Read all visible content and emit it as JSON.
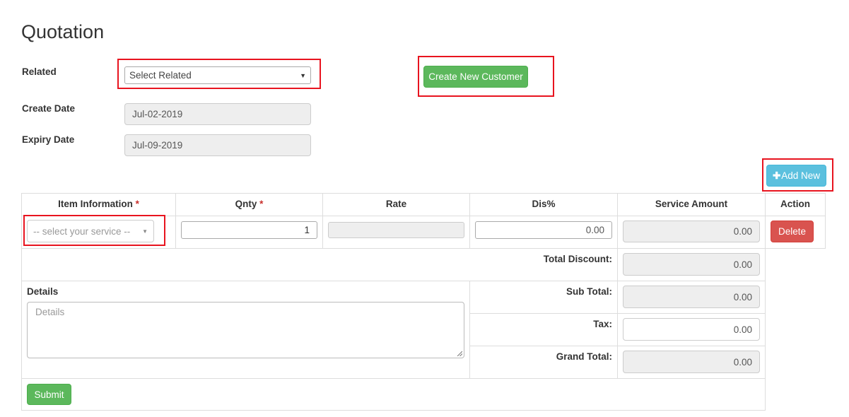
{
  "page": {
    "title": "Quotation"
  },
  "form": {
    "related_label": "Related",
    "related_value": "Select Related",
    "create_customer_label": "Create New Customer",
    "create_date_label": "Create Date",
    "create_date_value": "Jul-02-2019",
    "expiry_date_label": "Expiry Date",
    "expiry_date_value": "Jul-09-2019"
  },
  "table": {
    "add_new_label": "Add New",
    "headers": {
      "item": "Item Information",
      "qnty": "Qnty",
      "rate": "Rate",
      "dis": "Dis%",
      "amount": "Service Amount",
      "action": "Action"
    },
    "required_mark": "*",
    "row": {
      "service_placeholder": "-- select your service --",
      "qnty": "1",
      "rate": "",
      "dis": "0.00",
      "amount": "0.00",
      "delete_label": "Delete"
    }
  },
  "totals": {
    "total_discount_label": "Total Discount:",
    "total_discount": "0.00",
    "sub_total_label": "Sub Total:",
    "sub_total": "0.00",
    "tax_label": "Tax:",
    "tax": "0.00",
    "grand_total_label": "Grand Total:",
    "grand_total": "0.00"
  },
  "details": {
    "label": "Details",
    "placeholder": "Details",
    "value": ""
  },
  "submit_label": "Submit",
  "colors": {
    "accent_green": "#5cb85c",
    "accent_blue": "#5bc0de",
    "danger": "#d9534f",
    "highlight": "#e8141f"
  }
}
